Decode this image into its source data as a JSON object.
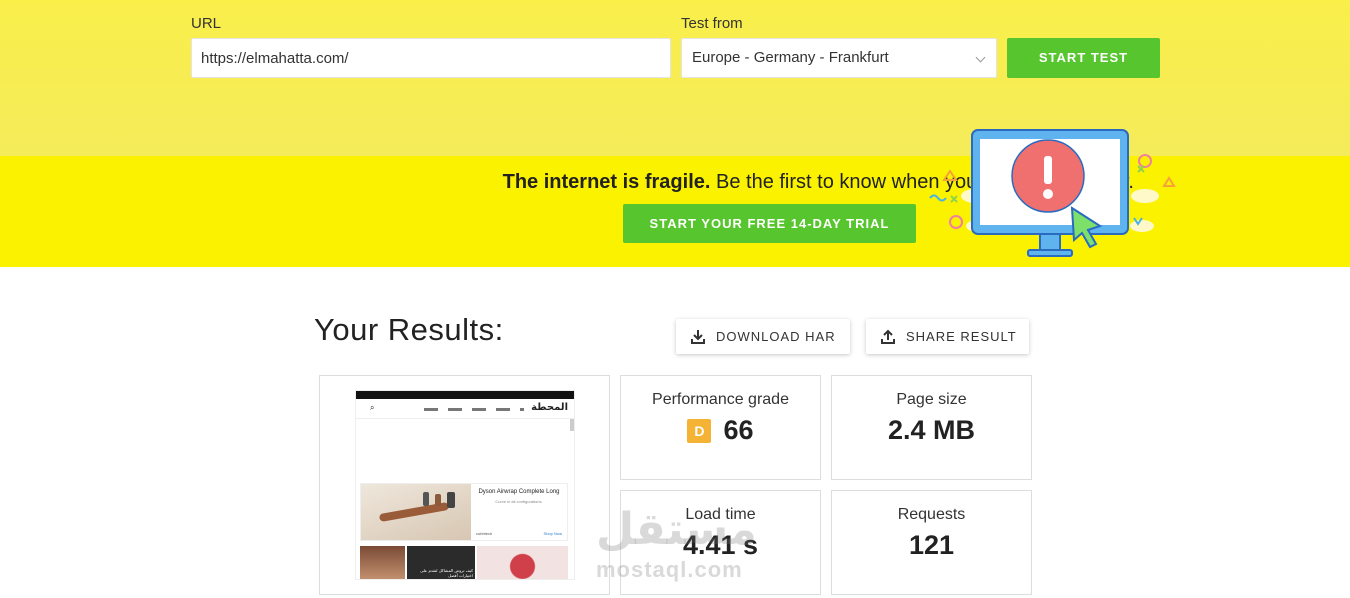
{
  "form": {
    "url_label": "URL",
    "url_value": "https://elmahatta.com/",
    "location_label": "Test from",
    "location_value": "Europe - Germany - Frankfurt",
    "start_button": "START TEST"
  },
  "banner": {
    "bold_text": "The internet is fragile.",
    "text": " Be the first to know when your site is in danger.",
    "trial_button": "START YOUR FREE 14-DAY TRIAL"
  },
  "results": {
    "title": "Your Results:",
    "download_button": "DOWNLOAD HAR",
    "share_button": "SHARE RESULT",
    "performance": {
      "label": "Performance grade",
      "grade": "D",
      "score": "66"
    },
    "page_size": {
      "label": "Page size",
      "value": "2.4 MB"
    },
    "load_time": {
      "label": "Load time",
      "value": "4.41 s"
    },
    "requests": {
      "label": "Requests",
      "value": "121"
    }
  },
  "thumbnail": {
    "site_logo": "المحطة",
    "ad_title": "Dyson Airwrap Complete Long",
    "ad_sub": "Curve in all configurations.",
    "ad_brand": "cobbtech",
    "ad_cta": "Shop Now",
    "article_caption": "كيف تروض المشاكل لتقدم على اختيارات أفضل"
  },
  "watermark": {
    "arabic": "مستقل",
    "latin": "mostaql.com"
  },
  "colors": {
    "top_bg": "#f9ee4a",
    "banner_bg": "#fbf200",
    "green": "#57c52e",
    "grade_d": "#f5b335"
  }
}
